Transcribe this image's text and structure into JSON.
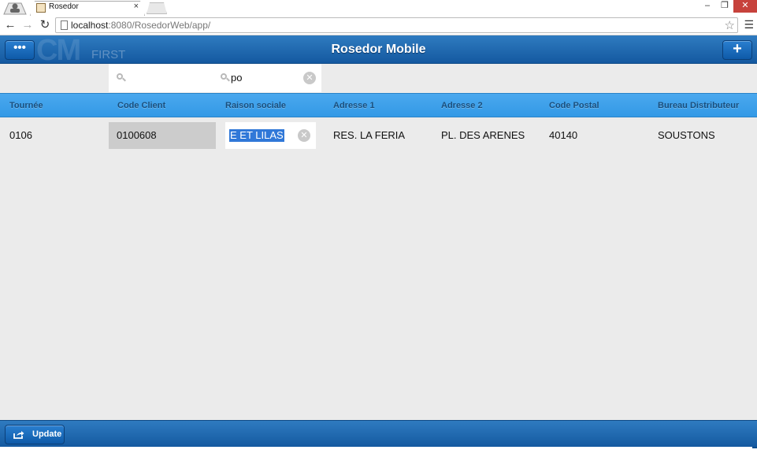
{
  "browser": {
    "tab_title": "Rosedor",
    "tab_close": "×",
    "url_host": "localhost",
    "url_rest": ":8080/RosedorWeb/app/",
    "win_minimize": "–",
    "win_restore": "❐",
    "win_close": "✕"
  },
  "app": {
    "title": "Rosedor Mobile",
    "menu_label": "•••",
    "add_label": "+",
    "logo_first": "FIRST",
    "logo_cm": "CM"
  },
  "filters": {
    "code_client_value": "",
    "raison_sociale_value": "po"
  },
  "table": {
    "columns": [
      "Tournée",
      "Code Client",
      "Raison sociale",
      "Adresse 1",
      "Adresse 2",
      "Code Postal",
      "Bureau Distributeur"
    ],
    "rows": [
      {
        "tournee": "0106",
        "code_client": "0100608",
        "raison_sociale": "E ET LILAS",
        "adresse1": "RES. LA FERIA",
        "adresse2": "PL. DES ARENES",
        "code_postal": "40140",
        "bureau": "SOUSTONS"
      }
    ]
  },
  "footer": {
    "update_label": "Update"
  },
  "colors": {
    "header_blue": "#1459a0",
    "column_header_blue": "#3399e6",
    "selection_blue": "#3078d8"
  }
}
